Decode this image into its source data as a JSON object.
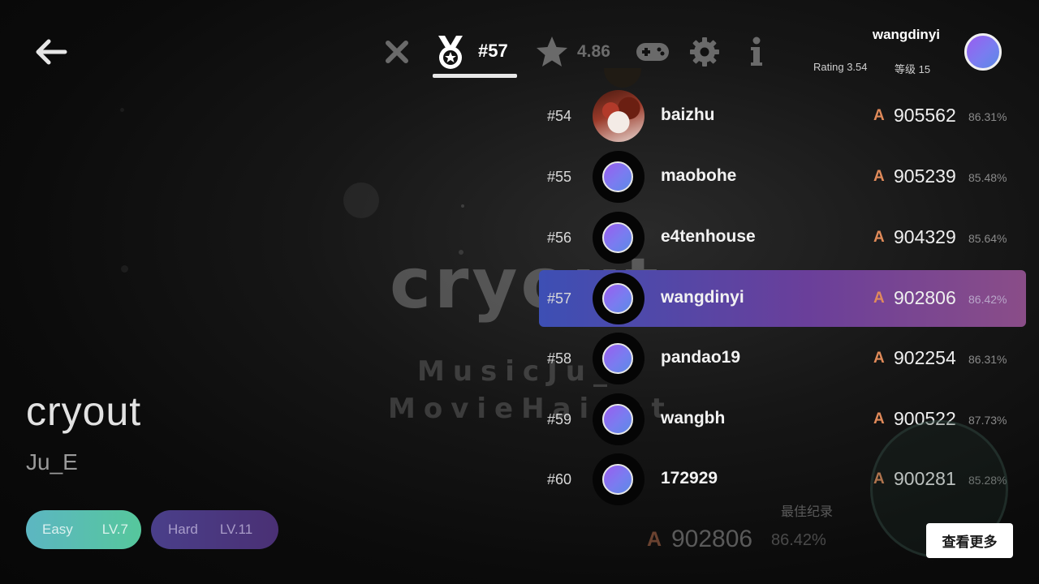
{
  "header": {
    "rank_tab_label": "#57",
    "rating_value": "4.86"
  },
  "user": {
    "name": "wangdinyi",
    "rating": "Rating 3.54",
    "level": "等级 15"
  },
  "background": {
    "title": "cryout",
    "line1": "MusicJu_",
    "line2": "MovieHaiget"
  },
  "song": {
    "title": "cryout",
    "artist": "Ju_E",
    "difficulties": [
      {
        "name": "Easy",
        "level": "LV.7"
      },
      {
        "name": "Hard",
        "level": "LV.11"
      }
    ]
  },
  "leaderboard": [
    {
      "rank": "#54",
      "name": "baizhu",
      "grade": "A",
      "score": "905562",
      "accuracy": "86.31%",
      "avatar": "photo"
    },
    {
      "rank": "#55",
      "name": "maobohe",
      "grade": "A",
      "score": "905239",
      "accuracy": "85.48%",
      "avatar": "default"
    },
    {
      "rank": "#56",
      "name": "e4tenhouse",
      "grade": "A",
      "score": "904329",
      "accuracy": "85.64%",
      "avatar": "default"
    },
    {
      "rank": "#57",
      "name": "wangdinyi",
      "grade": "A",
      "score": "902806",
      "accuracy": "86.42%",
      "avatar": "default",
      "highlight": true
    },
    {
      "rank": "#58",
      "name": "pandao19",
      "grade": "A",
      "score": "902254",
      "accuracy": "86.31%",
      "avatar": "default"
    },
    {
      "rank": "#59",
      "name": "wangbh",
      "grade": "A",
      "score": "900522",
      "accuracy": "87.73%",
      "avatar": "default"
    },
    {
      "rank": "#60",
      "name": "172929",
      "grade": "A",
      "score": "900281",
      "accuracy": "85.28%",
      "avatar": "default"
    }
  ],
  "best_record": {
    "label": "最佳纪录",
    "grade": "A",
    "score": "902806",
    "accuracy": "86.42%"
  },
  "more_button_label": "查看更多",
  "colors": {
    "highlight_start": "#3d4fb4",
    "highlight_end": "#8a4d88",
    "grade_color": "#e08a5a",
    "easy_start": "#5cb6c2",
    "easy_end": "#56c79c",
    "hard_start": "#4a3f8a",
    "hard_end": "#4a3074"
  },
  "icons": [
    "back-arrow-icon",
    "close-icon",
    "medal-icon",
    "star-icon",
    "gamepad-icon",
    "gear-icon",
    "info-icon"
  ]
}
